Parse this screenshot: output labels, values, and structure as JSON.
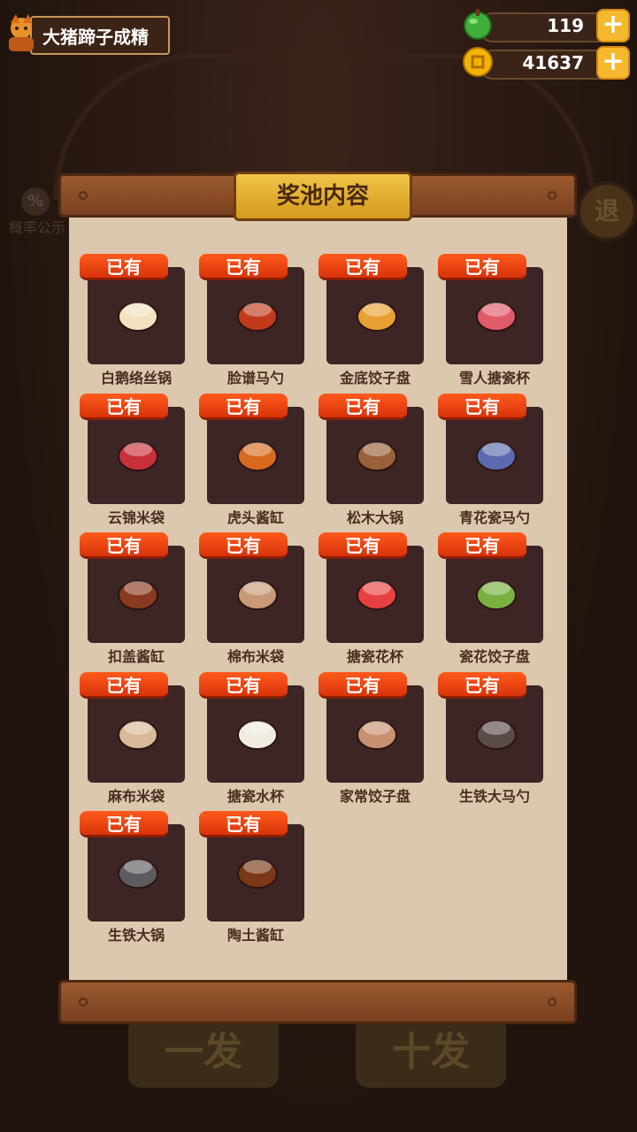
{
  "player": {
    "name": "大猪蹄子成精"
  },
  "currency": {
    "gems": "119",
    "coins": "41637",
    "colors": {
      "gem": "#3fae3a",
      "coin": "#f3b400"
    }
  },
  "background": {
    "probability_label": "概率公示",
    "exit_label": "退",
    "draw_one": "一发",
    "draw_ten": "十发"
  },
  "panel": {
    "title": "奖池内容",
    "owned_label": "已有",
    "items": [
      {
        "name": "白鹅络丝锅",
        "icon": "goose-pot-icon",
        "color": "#f2e2c0"
      },
      {
        "name": "脸谱马勺",
        "icon": "opera-ladle-icon",
        "color": "#c23a1c"
      },
      {
        "name": "金底饺子盘",
        "icon": "gold-dumpling-plate-icon",
        "color": "#e8a030"
      },
      {
        "name": "雪人搪瓷杯",
        "icon": "snowman-cup-icon",
        "color": "#e05a6a"
      },
      {
        "name": "云锦米袋",
        "icon": "brocade-rice-bag-icon",
        "color": "#c8303a"
      },
      {
        "name": "虎头酱缸",
        "icon": "tiger-sauce-jar-icon",
        "color": "#d86a20"
      },
      {
        "name": "松木大锅",
        "icon": "pine-pot-icon",
        "color": "#9a6038"
      },
      {
        "name": "青花瓷马勺",
        "icon": "porcelain-ladle-icon",
        "color": "#5a6ab0"
      },
      {
        "name": "扣盖酱缸",
        "icon": "lidded-sauce-jar-icon",
        "color": "#8a3a20"
      },
      {
        "name": "棉布米袋",
        "icon": "cotton-rice-bag-icon",
        "color": "#c89a78"
      },
      {
        "name": "搪瓷花杯",
        "icon": "flower-enamel-cup-icon",
        "color": "#e84040"
      },
      {
        "name": "瓷花饺子盘",
        "icon": "flower-dumpling-plate-icon",
        "color": "#7ab040"
      },
      {
        "name": "麻布米袋",
        "icon": "linen-rice-bag-icon",
        "color": "#d8b898"
      },
      {
        "name": "搪瓷水杯",
        "icon": "enamel-water-cup-icon",
        "color": "#f0ece0"
      },
      {
        "name": "家常饺子盘",
        "icon": "home-dumpling-plate-icon",
        "color": "#c89070"
      },
      {
        "name": "生铁大马勺",
        "icon": "iron-ladle-icon",
        "color": "#5a4a48"
      },
      {
        "name": "生铁大锅",
        "icon": "iron-pot-icon",
        "color": "#5c5c60"
      },
      {
        "name": "陶土酱缸",
        "icon": "clay-sauce-jar-icon",
        "color": "#7a3818"
      }
    ]
  }
}
